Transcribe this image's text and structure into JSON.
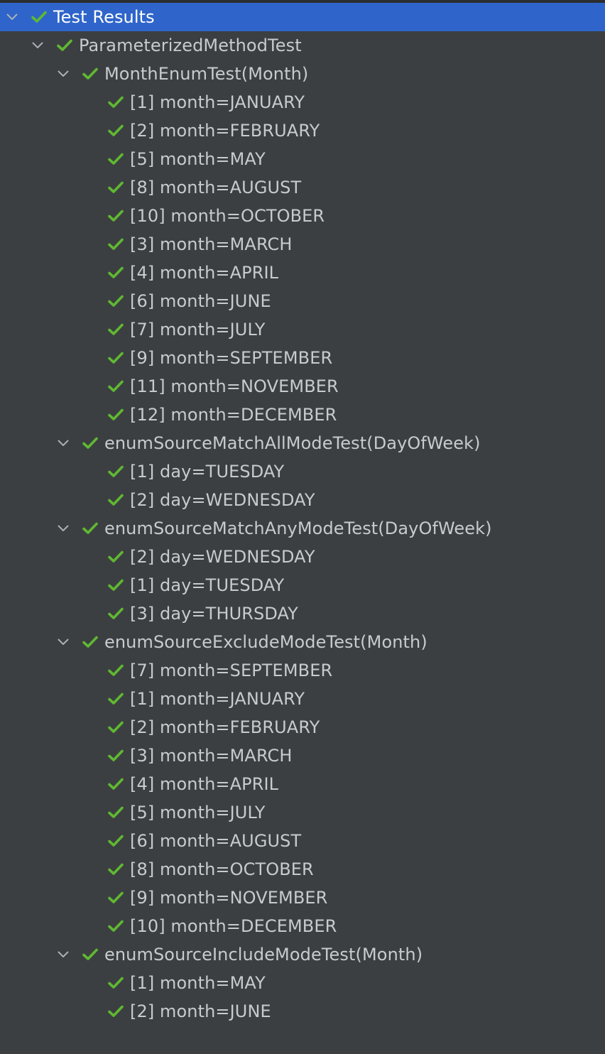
{
  "root": {
    "label": "Test Results",
    "status": "passed"
  },
  "suite": {
    "label": "ParameterizedMethodTest",
    "status": "passed"
  },
  "groups": [
    {
      "label": "MonthEnumTest(Month)",
      "items": [
        "[1] month=JANUARY",
        "[2] month=FEBRUARY",
        "[5] month=MAY",
        "[8] month=AUGUST",
        "[10] month=OCTOBER",
        "[3] month=MARCH",
        "[4] month=APRIL",
        "[6] month=JUNE",
        "[7] month=JULY",
        "[9] month=SEPTEMBER",
        "[11] month=NOVEMBER",
        "[12] month=DECEMBER"
      ]
    },
    {
      "label": "enumSourceMatchAllModeTest(DayOfWeek)",
      "items": [
        "[1] day=TUESDAY",
        "[2] day=WEDNESDAY"
      ]
    },
    {
      "label": "enumSourceMatchAnyModeTest(DayOfWeek)",
      "items": [
        "[2] day=WEDNESDAY",
        "[1] day=TUESDAY",
        "[3] day=THURSDAY"
      ]
    },
    {
      "label": "enumSourceExcludeModeTest(Month)",
      "items": [
        "[7] month=SEPTEMBER",
        "[1] month=JANUARY",
        "[2] month=FEBRUARY",
        "[3] month=MARCH",
        "[4] month=APRIL",
        "[5] month=JULY",
        "[6] month=AUGUST",
        "[8] month=OCTOBER",
        "[9] month=NOVEMBER",
        "[10] month=DECEMBER"
      ]
    },
    {
      "label": "enumSourceIncludeModeTest(Month)",
      "items": [
        "[1] month=MAY",
        "[2] month=JUNE"
      ]
    }
  ],
  "colors": {
    "background": "#3c3f41",
    "selection": "#2f65ca",
    "pass_check": "#5fb832",
    "text": "#c8cbce",
    "chevron": "#a9b0b6"
  },
  "icons": {
    "expand": "chevron-down-icon",
    "status": "check-icon"
  }
}
